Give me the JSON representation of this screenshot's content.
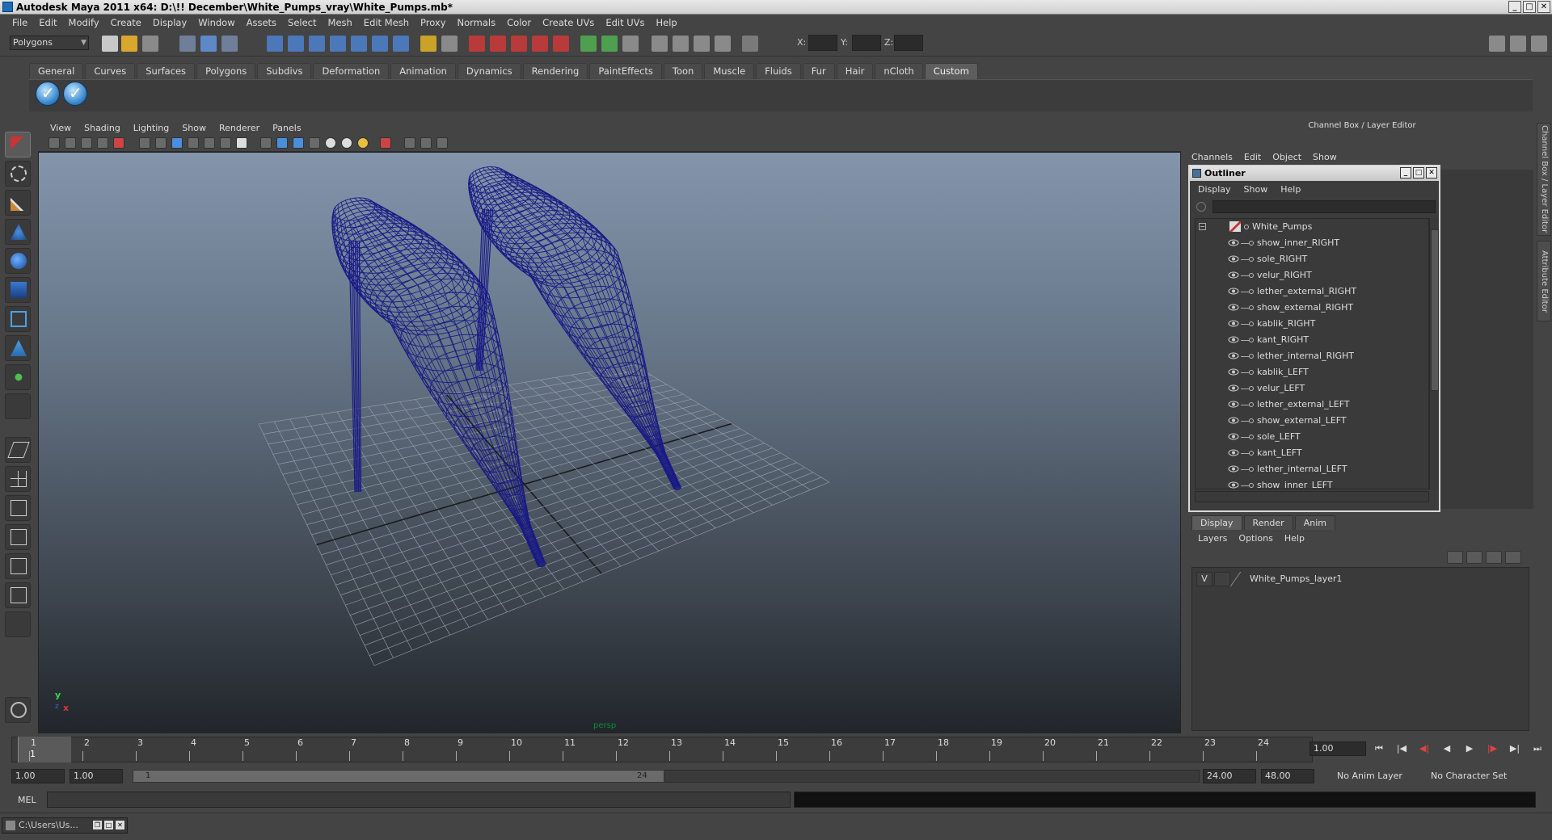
{
  "window": {
    "title": "Autodesk Maya 2011 x64: D:\\!! December\\White_Pumps_vray\\White_Pumps.mb*"
  },
  "menubar": [
    "File",
    "Edit",
    "Modify",
    "Create",
    "Display",
    "Window",
    "Assets",
    "Select",
    "Mesh",
    "Edit Mesh",
    "Proxy",
    "Normals",
    "Color",
    "Create UVs",
    "Edit UVs",
    "Help"
  ],
  "statusline": {
    "mode": "Polygons",
    "x_label": "X:",
    "y_label": "Y:",
    "z_label": "Z:"
  },
  "shelf": {
    "tabs": [
      "General",
      "Curves",
      "Surfaces",
      "Polygons",
      "Subdivs",
      "Deformation",
      "Animation",
      "Dynamics",
      "Rendering",
      "PaintEffects",
      "Toon",
      "Muscle",
      "Fluids",
      "Fur",
      "Hair",
      "nCloth",
      "Custom"
    ],
    "active_tab": "Custom"
  },
  "viewport": {
    "menu": [
      "View",
      "Shading",
      "Lighting",
      "Show",
      "Renderer",
      "Panels"
    ],
    "camera": "persp",
    "axis_y": "y",
    "axis_x": "x",
    "axis_z": "z",
    "wire_color": "#1a1a86"
  },
  "channel_box": {
    "title": "Channel Box / Layer Editor",
    "menu": [
      "Channels",
      "Edit",
      "Object",
      "Show"
    ]
  },
  "side_tabs": [
    "Channel Box / Layer Editor",
    "Attribute Editor"
  ],
  "outliner": {
    "title": "Outliner",
    "menu": [
      "Display",
      "Show",
      "Help"
    ],
    "root": "White_Pumps",
    "items": [
      "show_inner_RIGHT",
      "sole_RIGHT",
      "velur_RIGHT",
      "lether_external_RIGHT",
      "show_external_RIGHT",
      "kablik_RIGHT",
      "kant_RIGHT",
      "lether_internal_RIGHT",
      "kablik_LEFT",
      "velur_LEFT",
      "lether_external_LEFT",
      "show_external_LEFT",
      "sole_LEFT",
      "kant_LEFT",
      "lether_internal_LEFT",
      "show_inner_LEFT"
    ]
  },
  "layer_editor": {
    "tabs": [
      "Display",
      "Render",
      "Anim"
    ],
    "active_tab": "Display",
    "menu": [
      "Layers",
      "Options",
      "Help"
    ],
    "layers": [
      {
        "visible": "V",
        "name": "White_Pumps_layer1"
      }
    ]
  },
  "timeline": {
    "ticks": [
      "1",
      "2",
      "3",
      "4",
      "5",
      "6",
      "7",
      "8",
      "9",
      "10",
      "11",
      "12",
      "13",
      "14",
      "15",
      "16",
      "17",
      "18",
      "19",
      "20",
      "21",
      "22",
      "23",
      "24"
    ],
    "current_frame_marker": "1",
    "current_frame": "1.00"
  },
  "range": {
    "start": "1.00",
    "playback_start": "1.00",
    "range_start_label": "1",
    "range_end_label": "24",
    "playback_end": "24.00",
    "end": "48.00",
    "anim_layer": "No Anim Layer",
    "character_set": "No Character Set"
  },
  "command_line": {
    "label": "MEL"
  },
  "taskbar": {
    "item": "C:\\Users\\Us..."
  }
}
